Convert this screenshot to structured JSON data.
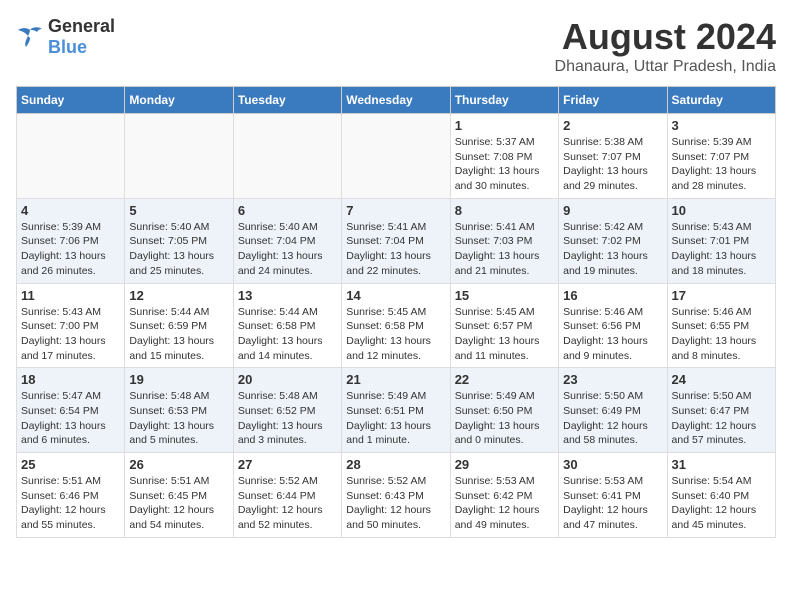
{
  "header": {
    "logo_general": "General",
    "logo_blue": "Blue",
    "month_title": "August 2024",
    "location": "Dhanaura, Uttar Pradesh, India"
  },
  "days_of_week": [
    "Sunday",
    "Monday",
    "Tuesday",
    "Wednesday",
    "Thursday",
    "Friday",
    "Saturday"
  ],
  "weeks": [
    [
      {
        "day": "",
        "info": ""
      },
      {
        "day": "",
        "info": ""
      },
      {
        "day": "",
        "info": ""
      },
      {
        "day": "",
        "info": ""
      },
      {
        "day": "1",
        "info": "Sunrise: 5:37 AM\nSunset: 7:08 PM\nDaylight: 13 hours\nand 30 minutes."
      },
      {
        "day": "2",
        "info": "Sunrise: 5:38 AM\nSunset: 7:07 PM\nDaylight: 13 hours\nand 29 minutes."
      },
      {
        "day": "3",
        "info": "Sunrise: 5:39 AM\nSunset: 7:07 PM\nDaylight: 13 hours\nand 28 minutes."
      }
    ],
    [
      {
        "day": "4",
        "info": "Sunrise: 5:39 AM\nSunset: 7:06 PM\nDaylight: 13 hours\nand 26 minutes."
      },
      {
        "day": "5",
        "info": "Sunrise: 5:40 AM\nSunset: 7:05 PM\nDaylight: 13 hours\nand 25 minutes."
      },
      {
        "day": "6",
        "info": "Sunrise: 5:40 AM\nSunset: 7:04 PM\nDaylight: 13 hours\nand 24 minutes."
      },
      {
        "day": "7",
        "info": "Sunrise: 5:41 AM\nSunset: 7:04 PM\nDaylight: 13 hours\nand 22 minutes."
      },
      {
        "day": "8",
        "info": "Sunrise: 5:41 AM\nSunset: 7:03 PM\nDaylight: 13 hours\nand 21 minutes."
      },
      {
        "day": "9",
        "info": "Sunrise: 5:42 AM\nSunset: 7:02 PM\nDaylight: 13 hours\nand 19 minutes."
      },
      {
        "day": "10",
        "info": "Sunrise: 5:43 AM\nSunset: 7:01 PM\nDaylight: 13 hours\nand 18 minutes."
      }
    ],
    [
      {
        "day": "11",
        "info": "Sunrise: 5:43 AM\nSunset: 7:00 PM\nDaylight: 13 hours\nand 17 minutes."
      },
      {
        "day": "12",
        "info": "Sunrise: 5:44 AM\nSunset: 6:59 PM\nDaylight: 13 hours\nand 15 minutes."
      },
      {
        "day": "13",
        "info": "Sunrise: 5:44 AM\nSunset: 6:58 PM\nDaylight: 13 hours\nand 14 minutes."
      },
      {
        "day": "14",
        "info": "Sunrise: 5:45 AM\nSunset: 6:58 PM\nDaylight: 13 hours\nand 12 minutes."
      },
      {
        "day": "15",
        "info": "Sunrise: 5:45 AM\nSunset: 6:57 PM\nDaylight: 13 hours\nand 11 minutes."
      },
      {
        "day": "16",
        "info": "Sunrise: 5:46 AM\nSunset: 6:56 PM\nDaylight: 13 hours\nand 9 minutes."
      },
      {
        "day": "17",
        "info": "Sunrise: 5:46 AM\nSunset: 6:55 PM\nDaylight: 13 hours\nand 8 minutes."
      }
    ],
    [
      {
        "day": "18",
        "info": "Sunrise: 5:47 AM\nSunset: 6:54 PM\nDaylight: 13 hours\nand 6 minutes."
      },
      {
        "day": "19",
        "info": "Sunrise: 5:48 AM\nSunset: 6:53 PM\nDaylight: 13 hours\nand 5 minutes."
      },
      {
        "day": "20",
        "info": "Sunrise: 5:48 AM\nSunset: 6:52 PM\nDaylight: 13 hours\nand 3 minutes."
      },
      {
        "day": "21",
        "info": "Sunrise: 5:49 AM\nSunset: 6:51 PM\nDaylight: 13 hours\nand 1 minute."
      },
      {
        "day": "22",
        "info": "Sunrise: 5:49 AM\nSunset: 6:50 PM\nDaylight: 13 hours\nand 0 minutes."
      },
      {
        "day": "23",
        "info": "Sunrise: 5:50 AM\nSunset: 6:49 PM\nDaylight: 12 hours\nand 58 minutes."
      },
      {
        "day": "24",
        "info": "Sunrise: 5:50 AM\nSunset: 6:47 PM\nDaylight: 12 hours\nand 57 minutes."
      }
    ],
    [
      {
        "day": "25",
        "info": "Sunrise: 5:51 AM\nSunset: 6:46 PM\nDaylight: 12 hours\nand 55 minutes."
      },
      {
        "day": "26",
        "info": "Sunrise: 5:51 AM\nSunset: 6:45 PM\nDaylight: 12 hours\nand 54 minutes."
      },
      {
        "day": "27",
        "info": "Sunrise: 5:52 AM\nSunset: 6:44 PM\nDaylight: 12 hours\nand 52 minutes."
      },
      {
        "day": "28",
        "info": "Sunrise: 5:52 AM\nSunset: 6:43 PM\nDaylight: 12 hours\nand 50 minutes."
      },
      {
        "day": "29",
        "info": "Sunrise: 5:53 AM\nSunset: 6:42 PM\nDaylight: 12 hours\nand 49 minutes."
      },
      {
        "day": "30",
        "info": "Sunrise: 5:53 AM\nSunset: 6:41 PM\nDaylight: 12 hours\nand 47 minutes."
      },
      {
        "day": "31",
        "info": "Sunrise: 5:54 AM\nSunset: 6:40 PM\nDaylight: 12 hours\nand 45 minutes."
      }
    ]
  ]
}
